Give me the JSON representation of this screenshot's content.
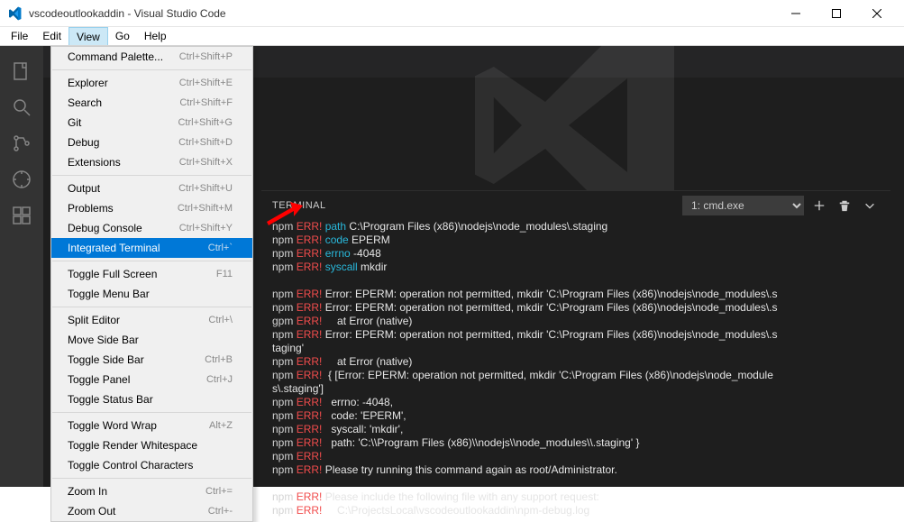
{
  "titlebar": {
    "title": "vscodeoutlookaddin - Visual Studio Code"
  },
  "menubar": [
    {
      "label": "File"
    },
    {
      "label": "Edit"
    },
    {
      "label": "View",
      "active": true
    },
    {
      "label": "Go"
    },
    {
      "label": "Help"
    }
  ],
  "dropdown": [
    {
      "type": "item",
      "label": "Command Palette...",
      "shortcut": "Ctrl+Shift+P"
    },
    {
      "type": "sep"
    },
    {
      "type": "item",
      "label": "Explorer",
      "shortcut": "Ctrl+Shift+E"
    },
    {
      "type": "item",
      "label": "Search",
      "shortcut": "Ctrl+Shift+F"
    },
    {
      "type": "item",
      "label": "Git",
      "shortcut": "Ctrl+Shift+G"
    },
    {
      "type": "item",
      "label": "Debug",
      "shortcut": "Ctrl+Shift+D"
    },
    {
      "type": "item",
      "label": "Extensions",
      "shortcut": "Ctrl+Shift+X"
    },
    {
      "type": "sep"
    },
    {
      "type": "item",
      "label": "Output",
      "shortcut": "Ctrl+Shift+U"
    },
    {
      "type": "item",
      "label": "Problems",
      "shortcut": "Ctrl+Shift+M"
    },
    {
      "type": "item",
      "label": "Debug Console",
      "shortcut": "Ctrl+Shift+Y"
    },
    {
      "type": "item",
      "label": "Integrated Terminal",
      "shortcut": "Ctrl+`",
      "highlighted": true
    },
    {
      "type": "sep"
    },
    {
      "type": "item",
      "label": "Toggle Full Screen",
      "shortcut": "F11"
    },
    {
      "type": "item",
      "label": "Toggle Menu Bar",
      "shortcut": ""
    },
    {
      "type": "sep"
    },
    {
      "type": "item",
      "label": "Split Editor",
      "shortcut": "Ctrl+\\"
    },
    {
      "type": "item",
      "label": "Move Side Bar",
      "shortcut": ""
    },
    {
      "type": "item",
      "label": "Toggle Side Bar",
      "shortcut": "Ctrl+B"
    },
    {
      "type": "item",
      "label": "Toggle Panel",
      "shortcut": "Ctrl+J"
    },
    {
      "type": "item",
      "label": "Toggle Status Bar",
      "shortcut": ""
    },
    {
      "type": "sep"
    },
    {
      "type": "item",
      "label": "Toggle Word Wrap",
      "shortcut": "Alt+Z"
    },
    {
      "type": "item",
      "label": "Toggle Render Whitespace",
      "shortcut": ""
    },
    {
      "type": "item",
      "label": "Toggle Control Characters",
      "shortcut": ""
    },
    {
      "type": "sep"
    },
    {
      "type": "item",
      "label": "Zoom In",
      "shortcut": "Ctrl+="
    },
    {
      "type": "item",
      "label": "Zoom Out",
      "shortcut": "Ctrl+-"
    }
  ],
  "panel": {
    "title": "TERMINAL",
    "selected": "1: cmd.exe"
  },
  "terminal": {
    "lines": [
      [
        [
          "npm ",
          "npm"
        ],
        [
          "ERR!",
          "err"
        ],
        [
          " path",
          "cyan"
        ],
        [
          " C:\\Program Files (x86)\\nodejs\\node_modules\\.staging",
          "white"
        ]
      ],
      [
        [
          "npm ",
          "npm"
        ],
        [
          "ERR!",
          "err"
        ],
        [
          " code",
          "cyan"
        ],
        [
          " EPERM",
          "white"
        ]
      ],
      [
        [
          "npm ",
          "npm"
        ],
        [
          "ERR!",
          "err"
        ],
        [
          " errno",
          "cyan"
        ],
        [
          " -4048",
          "white"
        ]
      ],
      [
        [
          "npm ",
          "npm"
        ],
        [
          "ERR!",
          "err"
        ],
        [
          " syscall",
          "cyan"
        ],
        [
          " mkdir",
          "white"
        ]
      ],
      [
        [
          "",
          "blank"
        ]
      ],
      [
        [
          "npm ",
          "npm"
        ],
        [
          "ERR!",
          "err"
        ],
        [
          " Error: EPERM: operation not permitted, mkdir 'C:\\Program Files (x86)\\nodejs\\node_modules\\.s",
          "white"
        ]
      ],
      [
        [
          "npm ",
          "npm"
        ],
        [
          "ERR!",
          "err"
        ],
        [
          " Error: EPERM: operation not permitted, mkdir 'C:\\Program Files (x86)\\nodejs\\node_modules\\.s",
          "white"
        ]
      ],
      [
        [
          "gpm ",
          "npm"
        ],
        [
          "ERR!",
          "err"
        ],
        [
          "     at Error (native)",
          "white"
        ]
      ],
      [
        [
          "npm ",
          "npm"
        ],
        [
          "ERR!",
          "err"
        ],
        [
          " Error: EPERM: operation not permitted, mkdir 'C:\\Program Files (x86)\\nodejs\\node_modules\\.s",
          "white"
        ]
      ],
      [
        [
          "taging'",
          "white"
        ]
      ],
      [
        [
          "npm ",
          "npm"
        ],
        [
          "ERR!",
          "err"
        ],
        [
          "     at Error (native)",
          "white"
        ]
      ],
      [
        [
          "npm ",
          "npm"
        ],
        [
          "ERR!",
          "err"
        ],
        [
          "  { [Error: EPERM: operation not permitted, mkdir 'C:\\Program Files (x86)\\nodejs\\node_module",
          "white"
        ]
      ],
      [
        [
          "s\\.staging']",
          "white"
        ]
      ],
      [
        [
          "npm ",
          "npm"
        ],
        [
          "ERR!",
          "err"
        ],
        [
          "   errno: -4048,",
          "white"
        ]
      ],
      [
        [
          "npm ",
          "npm"
        ],
        [
          "ERR!",
          "err"
        ],
        [
          "   code: 'EPERM',",
          "white"
        ]
      ],
      [
        [
          "npm ",
          "npm"
        ],
        [
          "ERR!",
          "err"
        ],
        [
          "   syscall: 'mkdir',",
          "white"
        ]
      ],
      [
        [
          "npm ",
          "npm"
        ],
        [
          "ERR!",
          "err"
        ],
        [
          "   path: 'C:\\\\Program Files (x86)\\\\nodejs\\\\node_modules\\\\.staging' }",
          "white"
        ]
      ],
      [
        [
          "npm ",
          "npm"
        ],
        [
          "ERR!",
          "err"
        ]
      ],
      [
        [
          "npm ",
          "npm"
        ],
        [
          "ERR!",
          "err"
        ],
        [
          " Please try running this command again as root/Administrator.",
          "white"
        ]
      ],
      [
        [
          "",
          "blank"
        ]
      ],
      [
        [
          "npm ",
          "npm"
        ],
        [
          "ERR!",
          "err"
        ],
        [
          " Please include the following file with any support request:",
          "white"
        ]
      ],
      [
        [
          "npm ",
          "npm"
        ],
        [
          "ERR!",
          "err"
        ],
        [
          "     C:\\ProjectsLocal\\vscodeoutlookaddin\\npm-debug.log",
          "white"
        ]
      ]
    ]
  }
}
